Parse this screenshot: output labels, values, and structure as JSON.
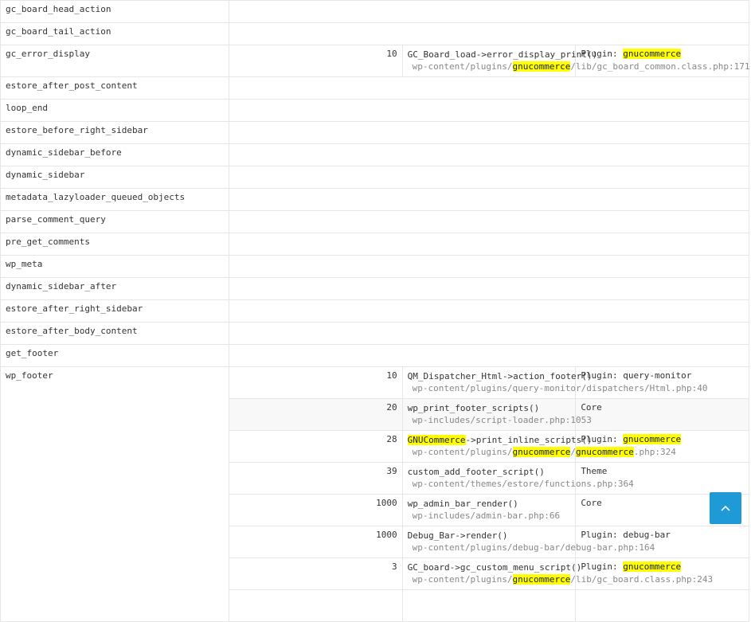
{
  "hooks_top": [
    "gc_board_head_action",
    "gc_board_tail_action"
  ],
  "gc_error_display": {
    "name": "gc_error_display",
    "priority": "10",
    "function": "GC_Board_load->error_display_print()",
    "file_pre": "wp-content/plugins/",
    "file_hl": "gnucommerce",
    "file_post": "/lib/gc_board_common.class.php:171",
    "component_pre": "Plugin: ",
    "component_hl": "gnucommerce"
  },
  "hooks_mid": [
    "estore_after_post_content",
    "loop_end",
    "estore_before_right_sidebar",
    "dynamic_sidebar_before",
    "dynamic_sidebar",
    "metadata_lazyloader_queued_objects",
    "parse_comment_query",
    "pre_get_comments",
    "wp_meta",
    "dynamic_sidebar_after",
    "estore_after_right_sidebar",
    "estore_after_body_content",
    "get_footer"
  ],
  "wp_footer": {
    "name": "wp_footer",
    "rows": [
      {
        "priority": "10",
        "function": "QM_Dispatcher_Html->action_footer()",
        "file": "wp-content/plugins/query-monitor/dispatchers/Html.php:40",
        "component": "Plugin: query-monitor"
      },
      {
        "priority": "20",
        "function": "wp_print_footer_scripts()",
        "file": "wp-includes/script-loader.php:1053",
        "component": "Core"
      },
      {
        "priority": "28",
        "function_hl": "GNUCommerce",
        "function_post": "->print_inline_scripts()",
        "file_pre": "wp-content/plugins/",
        "file_hl1": "gnucommerce",
        "file_mid": "/",
        "file_hl2": "gnucommerce",
        "file_post": ".php:324",
        "component_pre": "Plugin: ",
        "component_hl": "gnucommerce"
      },
      {
        "priority": "39",
        "function": "custom_add_footer_script()",
        "file": "wp-content/themes/estore/functions.php:364",
        "component": "Theme"
      },
      {
        "priority": "1000",
        "function": "wp_admin_bar_render()",
        "file": "wp-includes/admin-bar.php:66",
        "component": "Core"
      },
      {
        "priority": "1000",
        "function": "Debug_Bar->render()",
        "file": "wp-content/plugins/debug-bar/debug-bar.php:164",
        "component": "Plugin: debug-bar"
      },
      {
        "priority": "3",
        "function": "GC_board->gc_custom_menu_script()",
        "file_pre": "wp-content/plugins/",
        "file_hl": "gnucommerce",
        "file_post": "/lib/gc_board.class.php:243",
        "component_pre": "Plugin: ",
        "component_hl": "gnucommerce"
      }
    ]
  },
  "scroll_top": {
    "icon": "chevron-up-icon",
    "color": "#1e9ad6"
  },
  "colors": {
    "highlight": "#ffff00",
    "border": "#e6e6e6",
    "file_text": "#888888"
  }
}
